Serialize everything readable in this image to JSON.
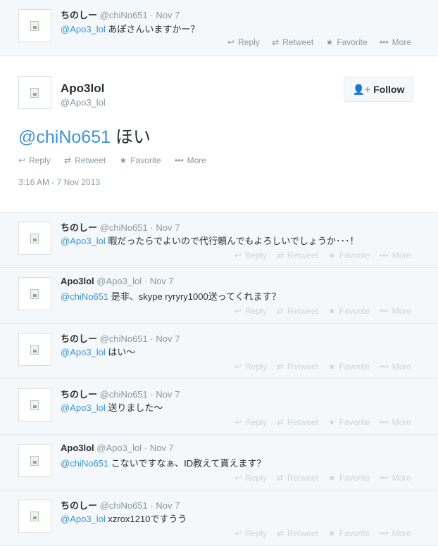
{
  "top_tweet": {
    "name": "ちのしー",
    "screen": "@chiNo651",
    "time": "Nov 7",
    "mention": "@Apo3_lol",
    "text": " あぽさんいますかー？"
  },
  "focused": {
    "name": "Apo3lol",
    "screen": "@Apo3_lol",
    "follow_label": "Follow",
    "mention": "@chiNo651",
    "text": " ほい",
    "timestamp": "3:16 AM - 7 Nov 2013"
  },
  "actions": {
    "reply": "Reply",
    "retweet": "Retweet",
    "favorite": "Favorite",
    "more": "More"
  },
  "replies": [
    {
      "name": "ちのしー",
      "screen": "@chiNo651",
      "time": "Nov 7",
      "mention": "@Apo3_lol",
      "text": " 暇だったらでよいので代行頼んでもよろしいでしょうか･･･！"
    },
    {
      "name": "Apo3lol",
      "screen": "@Apo3_lol",
      "time": "Nov 7",
      "mention": "@chiNo651",
      "text": " 是非、skype ryryry1000送ってくれます？"
    },
    {
      "name": "ちのしー",
      "screen": "@chiNo651",
      "time": "Nov 7",
      "mention": "@Apo3_lol",
      "text": " はい～"
    },
    {
      "name": "ちのしー",
      "screen": "@chiNo651",
      "time": "Nov 7",
      "mention": "@Apo3_lol",
      "text": " 送りました～"
    },
    {
      "name": "Apo3lol",
      "screen": "@Apo3_lol",
      "time": "Nov 7",
      "mention": "@chiNo651",
      "text": " こないですなぁ、ID教えて貰えます？"
    },
    {
      "name": "ちのしー",
      "screen": "@chiNo651",
      "time": "Nov 7",
      "mention": "@Apo3_lol",
      "text": " xzrox1210ですうう"
    }
  ]
}
